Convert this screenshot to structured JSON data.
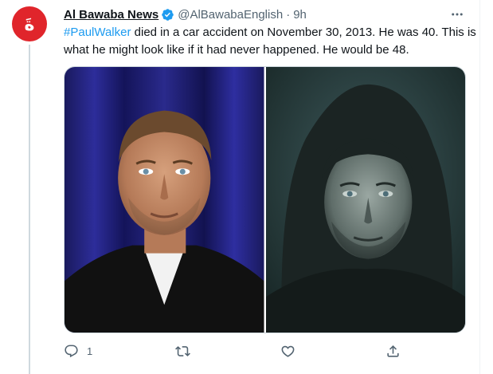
{
  "tweet": {
    "author_name": "Al Bawaba News",
    "handle": "@AlBawabaEnglish",
    "separator": "·",
    "time": "9h",
    "hashtag": "#PaulWalker",
    "text": " died in a car accident on November 30, 2013. He was 40. This is what he might look like if it had never happened. He would be 48.",
    "avatar_glyph": "ةَ"
  },
  "media": {
    "left_image": "photo-portrait-actor",
    "right_image": "photo-aged-portrait-hooded"
  },
  "actions": {
    "reply_count": "1",
    "retweet_count": "",
    "like_count": ""
  },
  "colors": {
    "link": "#1d9bf0",
    "brand": "#e0252b",
    "muted": "#536471"
  }
}
